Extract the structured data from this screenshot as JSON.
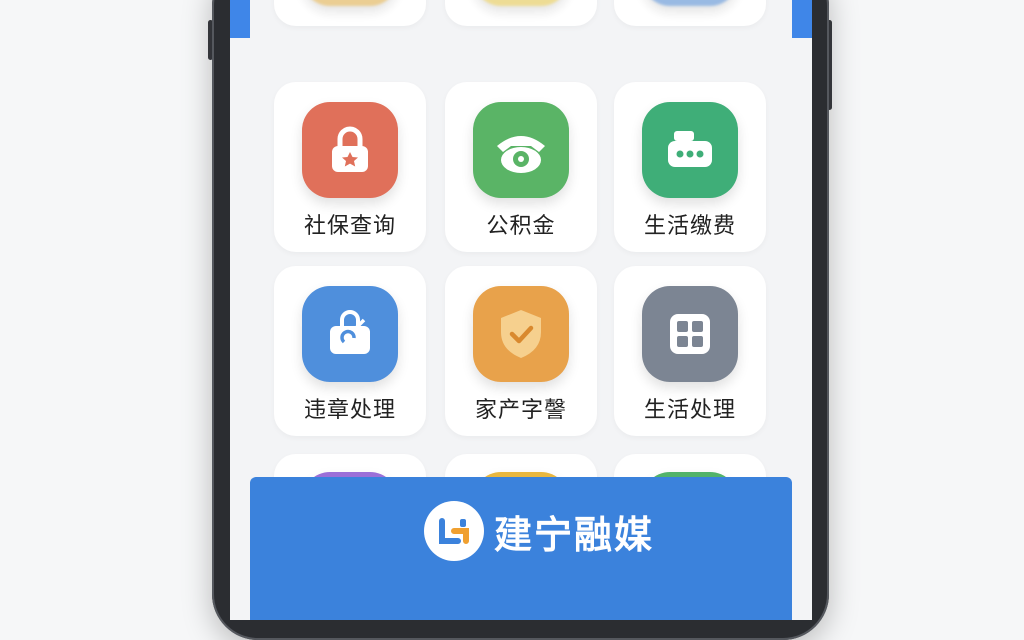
{
  "services": [
    {
      "label": "社保查询",
      "icon": "lock-star-icon",
      "color": "#e0705a"
    },
    {
      "label": "公积金",
      "icon": "rotary-phone-icon",
      "color": "#5ab466"
    },
    {
      "label": "生活缴费",
      "icon": "ticket-card-icon",
      "color": "#3fae78"
    },
    {
      "label": "违章处理",
      "icon": "shopping-bag-icon",
      "color": "#4f8fdc"
    },
    {
      "label": "家产字謦",
      "icon": "shield-check-icon",
      "color": "#e8a24b"
    },
    {
      "label": "生活处理",
      "icon": "grid-apps-icon",
      "color": "#7c8593"
    }
  ],
  "top_row_icons": [
    {
      "icon": "medal-badge-icon",
      "color": "#e9c988"
    },
    {
      "icon": "shop-market-icon",
      "color": "#ecd98a"
    },
    {
      "icon": "car-icon",
      "color": "#8fb3e0"
    }
  ],
  "bottom_row_icons": [
    {
      "icon": "partial-app-icon",
      "color": "#9b6fd8"
    },
    {
      "icon": "partial-app-icon",
      "color": "#e9b73f"
    },
    {
      "icon": "partial-app-icon",
      "color": "#52b36a"
    }
  ],
  "brand": {
    "name": "建宁融媒",
    "logo": "jianning-logo-icon",
    "bar_color": "#3b82dc"
  }
}
